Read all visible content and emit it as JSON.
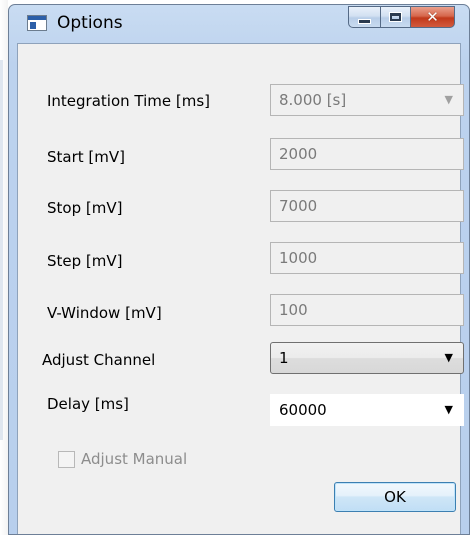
{
  "window": {
    "title": "Options",
    "icon": "window-app-icon",
    "controls": {
      "minimize_icon": "minimize-icon",
      "maximize_icon": "maximize-icon",
      "close_icon": "close-icon",
      "close_glyph": "✕"
    }
  },
  "form": {
    "integration_time": {
      "label": "Integration Time [ms]",
      "value": "8.000 [s]",
      "enabled": false
    },
    "start": {
      "label": "Start [mV]",
      "value": "2000",
      "enabled": false
    },
    "stop": {
      "label": "Stop [mV]",
      "value": "7000",
      "enabled": false
    },
    "step": {
      "label": "Step [mV]",
      "value": "1000",
      "enabled": false
    },
    "v_window": {
      "label": "V-Window [mV]",
      "value": "100",
      "enabled": false
    },
    "adjust_channel": {
      "label": "Adjust Channel",
      "value": "1",
      "enabled": true
    },
    "delay": {
      "label": "Delay [ms]",
      "value": "60000",
      "enabled": true
    },
    "adjust_manual": {
      "label": "Adjust Manual",
      "checked": false,
      "enabled": false
    }
  },
  "buttons": {
    "ok_label": "OK"
  },
  "colors": {
    "titlebar": "#bcd2ee",
    "client_background": "#f0f0f0",
    "close_button": "#c1391b",
    "ok_button_border": "#3c7fb1",
    "disabled_text": "#7a7a7a"
  }
}
